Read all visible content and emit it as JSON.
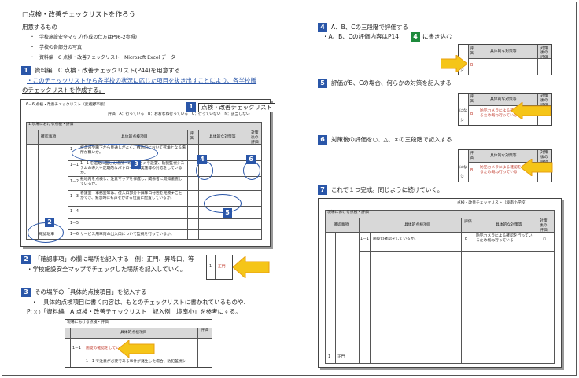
{
  "left": {
    "title": "□点検・改善チェックリストを作ろう",
    "prep_heading": "用意するもの",
    "prep_items": [
      "・　学校施設安全マップ(作成の仕方はP96-2参照)",
      "・　学校の各部分の写真",
      "・　資料編　C 点検・改善チェックリスト　Microsoft Excel データ"
    ],
    "step1_num": "1",
    "step1_text": "資料編　C 点検・改善チェックリスト(P44)を用意する",
    "step1_note_line1": "・このチェックリストから各学校の状況に応じた項目を抜き出すことにより、各学校版",
    "step1_note_line2": "のチェックリストを作成する。",
    "sheet": {
      "title": "6－6.点検・改善チェックリスト（武蔵野市版）",
      "legend": "評価　A：行っている　B：おおむね行っている　C：行っていない　N：該当しない",
      "section": "1 現場における点検・評価",
      "col_location": "確認事項",
      "col_item": "具体的点検項目",
      "col_eval": "評価",
      "col_measure": "具体的な対策等",
      "col_after": "対策後の評価",
      "rows": [
        {
          "no": "1",
          "text": "校舎内や廊下から見通しがよく、敷地内において死角となる場所が無いか。"
        },
        {
          "no": "1－1",
          "text": "1－1 を道路に面した場所への監視カメラ設置、防犯監視システムの導入や定期的なパトロールの実施等の対応をしているか。"
        },
        {
          "no": "1－2",
          "text": "敷地内を点検し、注意マップを作成し、関係者に周知徹底しているか。"
        },
        {
          "no": "1－3",
          "text": "看護室・事務室等は、侵入口部分や昇降口付近を見渡すことができ、緊急時にも声をかける位置に配置しているか。"
        },
        {
          "no": "1－4",
          "text": ""
        },
        {
          "no": "1－5",
          "text": ""
        },
        {
          "no": "1－6",
          "text": "サービス用車両の出入口について監視を行っているか。"
        }
      ],
      "location_value": "確認駐車",
      "overlay_label": "点検・改善チェックリスト",
      "overlay_num": "1",
      "c3": "3",
      "c4": "4",
      "c5": "5",
      "c6": "6",
      "c2": "2"
    },
    "step2_num": "2",
    "step2_text": "「確認事項」の欄に場所を記入する　例：正門、昇降口、等",
    "step2_note": "・学校施設安全マップでチェックした場所を記入していく。",
    "step2_sample_no": "1",
    "step2_sample_val": "正門",
    "step3_num": "3",
    "step3_text": "その場所の「具体的点検項目」を記入する",
    "step3_note_line1": "・　具体的点検項目に書く内容は、もとのチェックリストに書かれているものや、",
    "step3_note_line2": "P○○「資料編　A 点検・改善チェックリスト　記入例　境南小」を参考にする。",
    "step3_sample": {
      "section": "現場における点検・評価",
      "col_item": "具体的点検項目",
      "col_eval": "評価",
      "row1_no": "1－1",
      "row1_text": "施錠の確認をしているか",
      "row2_text": "1－1 で注意が必要である事件が発生した場合、防犯監視シ"
    }
  },
  "right": {
    "step4_num": "4",
    "step4_text": "A、B、Cの三段階で評価する",
    "step4_note_pre": "・A、B、Cの評価内容はP14",
    "step4_note_badge": "4",
    "step4_note_post": "に書き込む",
    "step4_sample": {
      "col_eval": "評価",
      "col_measure": "具体的な対策等",
      "col_after": "対策後の評価",
      "value": "B",
      "left": "シ"
    },
    "step5_num": "5",
    "step5_text": "評価がB、Cの場合、何らかの対策を記入する",
    "step5_sample": {
      "col_eval": "評価",
      "col_measure": "具体的な対策等",
      "col_after": "対策後の評価",
      "value": "B",
      "left_top": "にな",
      "left_bot": "シ",
      "measure": "防犯カメラによる確認を行っているため概ね行っている"
    },
    "step6_num": "6",
    "step6_text": "対策後の評価を○、△、×の三段階で記入する",
    "step6_sample": {
      "col_eval": "評価",
      "col_measure": "具体的な対策等",
      "col_after": "対策後の評価",
      "value": "B",
      "left_top": "にな",
      "left_bot": "シ",
      "measure": "防犯カメラによる確認を行っているため概ね行っている",
      "after": "○"
    },
    "step7_num": "7",
    "step7_text": "これで１つ完成。同じように続けていく。",
    "final": {
      "header": "点検・改善チェックリスト（境南小学校）",
      "section": "現場における点検・評価",
      "col_location": "確認事項",
      "col_item": "具体的点検項目",
      "col_eval": "評価",
      "col_measure": "具体的な対策等",
      "col_after": "対策後の評価",
      "row_no": "1－1",
      "row_text": "施錠の確認をしているか。",
      "row_eval": "B",
      "row_measure": "防犯カメラによる確認を行っているため概ね行っている",
      "row_after": "○",
      "loc_no": "1",
      "loc_val": "正門"
    }
  },
  "colors": {
    "accent_blue": "#2a56a8",
    "accent_green": "#1e8a3c",
    "arrow_yellow": "#f5c518",
    "arrow_orange": "#e8a010"
  }
}
